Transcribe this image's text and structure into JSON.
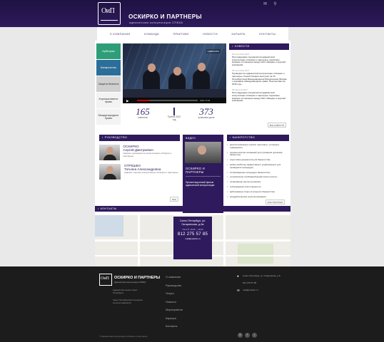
{
  "header": {
    "logo_text": "ОиП",
    "title": "ОСКИРКО И ПАРТНЕРЫ",
    "subtitle": "адвокатская консультация СПБКА",
    "icons": [
      "mail-icon",
      "search-icon"
    ]
  },
  "nav": {
    "items": [
      "О КОМПАНИИ",
      "КОМАНДА",
      "ПРАКТИКИ",
      "НОВОСТИ",
      "КАРЬЕРА",
      "КОНТАКТЫ"
    ]
  },
  "left_menu": {
    "items": [
      "Арбитраж",
      "Банкротство",
      "Защита бизнеса",
      "Корпоративное право",
      "Международное право"
    ]
  },
  "video": {
    "timecode": "0:00 / 6:41",
    "badge": "АДВОКАТЫ"
  },
  "stats": {
    "clients": {
      "number": "165",
      "label": "клиентов"
    },
    "year": {
      "number": "Третий 2012",
      "label": "год"
    },
    "cases": {
      "number": "373",
      "label": "успешных дела"
    }
  },
  "news": {
    "title": "НОВОСТИ",
    "items": [
      {
        "date": "05 сентября 2017",
        "text": "При поддержке специалистов адвокатской консультации «Оскирко и партнеры» подписано мировое соглашение между ОАО «Звезда» и крупной компанией."
      },
      {
        "date": "05 сентября 2017",
        "text": "Руководитель адвокатской консультации «Оскирко и партнеры» Сергей Оскирко выступил на VII Петербургском Международном Юридическом Форуме с докладом «Международное право. Перспективы на 2016 год»."
      },
      {
        "date": "08 августа 2017",
        "text": "При поддержке специалистов адвокатской консультации «Оскирко и партнеры» подписано мировое соглашение между ОАО «Звезда» и крупной компанией."
      }
    ],
    "all_label": "ВСЕ НОВОСТИ"
  },
  "leadership": {
    "title": "РУКОВОДСТВО",
    "people": [
      {
        "name_first": "ОСКИРКО",
        "name_full": "Сергей Дмитриевич",
        "desc": "Адвокат, руководитель консультации «Оскирко и партнеры»"
      },
      {
        "name_first": "ОТРЕШКО",
        "name_full": "Татьяна Александровна",
        "desc": "Адвокат, партнер консультации «Оскирко и партнеры»"
      }
    ],
    "all_label": "ВСЕ"
  },
  "video_block": {
    "title": "ВИДЕО",
    "name": "ОСКИРКО И ПАРТНЕРЫ",
    "desc": "Презентационный фильм адвокатской консультации",
    "btn": "ВСЕ ВИДЕО"
  },
  "bankruptcy": {
    "title": "БАНКРОТСТВО",
    "items": [
      "анализ возможных рисков: налоговых, уголовных, гражданских;",
      "оценка наличия оснований для признания должника банкротом;",
      "подготовка документов для банкротства;",
      "выбор наиболее эффективного управляющего для проведения процедуры;",
      "сопровождение процедуры банкротства;",
      "установление требований кредиторов в реестр;",
      "оспаривание сделок должника;",
      "субсидиарная ответственность;",
      "арбитражные споры в процессе банкротства;",
      "преддебиторские консультирование;"
    ],
    "link": "ВСЕ ПРАКТИКИ"
  },
  "contacts": {
    "title": "КОНТАКТЫ"
  },
  "map": {
    "address": "Санкт-Петербург, ул. Гагаринская, д.6а",
    "hours": "ПН–ПТ 10:00 – 19:00",
    "phone": "812 275 57 85",
    "email": "mail@oskirko.ru"
  },
  "footer": {
    "logo_text": "ОиП",
    "title": "ОСКИРКО И ПАРТНЕРЫ",
    "subtitle": "адвокатская консультация СПБКА",
    "left1": "Адвокатская палата Санкт-Петербурга",
    "left2": "Санкт-Петербургская Городская коллегия адвокатов",
    "nav": [
      "О компании",
      "Руководство",
      "Услуги",
      "Новости",
      "Мероприятия",
      "Карьера",
      "Контакты"
    ],
    "address": "Санкт-Петербург, ул. Гагаринская, д.6",
    "phone": "812 275 57 85",
    "email": "mail@oskirko.ru",
    "copy": "© Адвокатская консультация «Оскирко и партнеры»"
  }
}
